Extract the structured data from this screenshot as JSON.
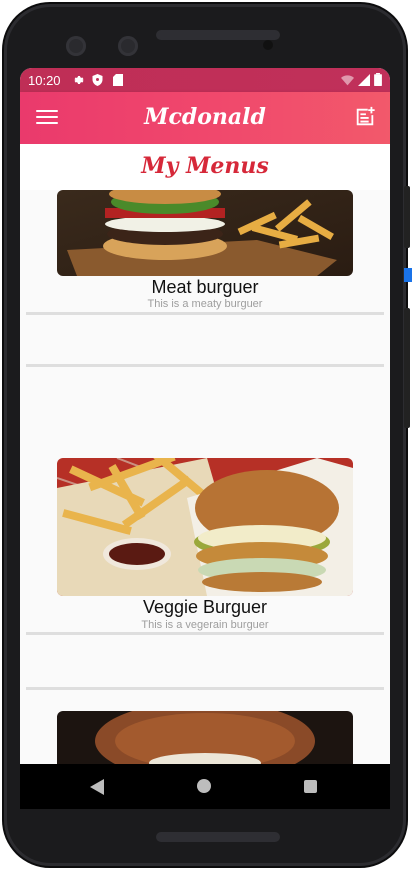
{
  "status_bar": {
    "time": "10:20",
    "icons": [
      "settings-icon",
      "shield-icon",
      "sd-card-icon",
      "wifi-icon",
      "signal-icon",
      "battery-icon"
    ]
  },
  "app_bar": {
    "title": "Mcdonald",
    "left_icon": "menu-icon",
    "right_icon": "add-note-icon",
    "gradient": [
      "#ea3a6c",
      "#f2596b"
    ]
  },
  "page": {
    "title": "My Menus",
    "title_color": "#d62839"
  },
  "menu_items": [
    {
      "name": "Meat burguer",
      "description": "This is a meaty burguer",
      "image": "meat-burger-photo"
    },
    {
      "name": "Veggie Burguer",
      "description": "This is a vegerain burguer",
      "image": "veggie-burger-photo"
    },
    {
      "name": "",
      "description": "",
      "image": "stacked-burger-photo"
    }
  ],
  "nav_bar": {
    "buttons": [
      "back-icon",
      "home-icon",
      "recents-icon"
    ]
  }
}
